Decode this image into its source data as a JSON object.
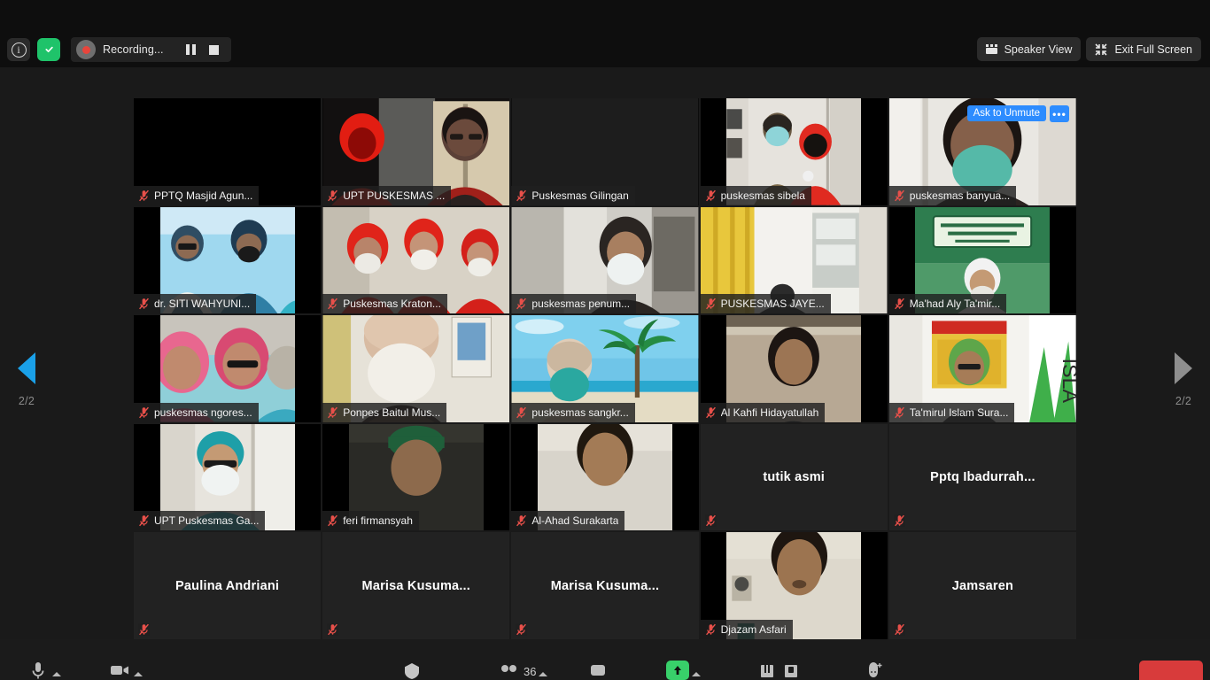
{
  "app": {
    "title": "Zoom Meeting"
  },
  "topbar": {
    "info_icon": "info-icon",
    "encryption_icon": "shield-check-icon",
    "recording_label": "Recording...",
    "pause_icon": "pause-icon",
    "stop_icon": "stop-icon",
    "speaker_view_label": "Speaker View",
    "exit_full_screen_label": "Exit Full Screen"
  },
  "pager": {
    "prev_label": "2/2",
    "next_label": "2/2",
    "prev_icon": "chevron-left-icon",
    "next_icon": "chevron-right-icon",
    "prev_color": "#1aa0e8",
    "next_color": "#8e8e8e"
  },
  "overlay": {
    "ask_to_unmute": "Ask to Unmute",
    "more_options": "•••"
  },
  "gallery": {
    "participants": [
      {
        "name": "PPTQ Masjid Agun...",
        "muted": true,
        "video": "off-black",
        "label_mode": "bar"
      },
      {
        "name": "UPT PUSKESMAS ...",
        "muted": true,
        "video": "room-red-batik",
        "label_mode": "bar"
      },
      {
        "name": "Puskesmas Gilingan",
        "muted": true,
        "video": "off-dark",
        "label_mode": "bar"
      },
      {
        "name": "puskesmas sibela",
        "muted": true,
        "video": "two-people-office",
        "label_mode": "bar"
      },
      {
        "name": "puskesmas banyua...",
        "muted": true,
        "video": "man-green-mask",
        "label_mode": "bar",
        "ask_to_unmute": true
      },
      {
        "name": "dr. SITI WAHYUNI...",
        "muted": true,
        "video": "two-women-blue",
        "label_mode": "bar"
      },
      {
        "name": "Puskesmas Kraton...",
        "muted": true,
        "video": "three-red-hijab",
        "label_mode": "bar"
      },
      {
        "name": "puskesmas penum...",
        "muted": true,
        "video": "woman-mask-hall",
        "label_mode": "bar"
      },
      {
        "name": "PUSKESMAS JAYE...",
        "muted": true,
        "video": "yellow-curtain-room",
        "label_mode": "bar"
      },
      {
        "name": "Ma'had Aly Ta'mir...",
        "muted": true,
        "video": "elder-green-banner",
        "label_mode": "bar"
      },
      {
        "name": "puskesmas ngores...",
        "muted": true,
        "video": "women-pink-hijab",
        "label_mode": "bar"
      },
      {
        "name": "Ponpes Baitul Mus...",
        "muted": true,
        "video": "man-white-mask",
        "label_mode": "bar"
      },
      {
        "name": "puskesmas sangkr...",
        "muted": true,
        "video": "beach-palm",
        "label_mode": "bar"
      },
      {
        "name": "Al Kahfi Hidayatullah",
        "muted": true,
        "video": "man-dark-shirt",
        "label_mode": "bar"
      },
      {
        "name": "Ta'mirul Islam Sura...",
        "muted": true,
        "video": "green-logo-banner",
        "label_mode": "bar"
      },
      {
        "name": "UPT Puskesmas Ga...",
        "muted": true,
        "video": "woman-teal-scrub",
        "label_mode": "bar"
      },
      {
        "name": "feri firmansyah",
        "muted": true,
        "video": "man-peci-dark",
        "label_mode": "bar"
      },
      {
        "name": "Al-Ahad Surakarta",
        "muted": true,
        "video": "young-man-white",
        "label_mode": "bar"
      },
      {
        "name": "tutik asmi",
        "muted": true,
        "video": "none",
        "label_mode": "center"
      },
      {
        "name": "Pptq  Ibadurrah...",
        "muted": true,
        "video": "none",
        "label_mode": "center"
      },
      {
        "name": "Paulina Andriani",
        "muted": true,
        "video": "none",
        "label_mode": "center"
      },
      {
        "name": "Marisa  Kusuma...",
        "muted": true,
        "video": "none",
        "label_mode": "center"
      },
      {
        "name": "Marisa  Kusuma...",
        "muted": true,
        "video": "none",
        "label_mode": "center"
      },
      {
        "name": "Djazam Asfari",
        "muted": true,
        "video": "man-portrait-wall",
        "label_mode": "bar"
      },
      {
        "name": "Jamsaren",
        "muted": true,
        "video": "none",
        "label_mode": "center"
      }
    ]
  },
  "bottombar": {
    "mute_icon": "microphone-icon",
    "video_icon": "video-camera-icon",
    "share_screen_icon": "share-screen-icon",
    "participants_icon": "participants-icon",
    "participants_count": "36",
    "chat_icon": "chat-icon",
    "record_icon": "record-upload-icon",
    "pause_recording_icon": "pause-icon",
    "stop_recording_icon": "stop-icon",
    "reactions_icon": "reactions-icon",
    "end_label": ""
  }
}
